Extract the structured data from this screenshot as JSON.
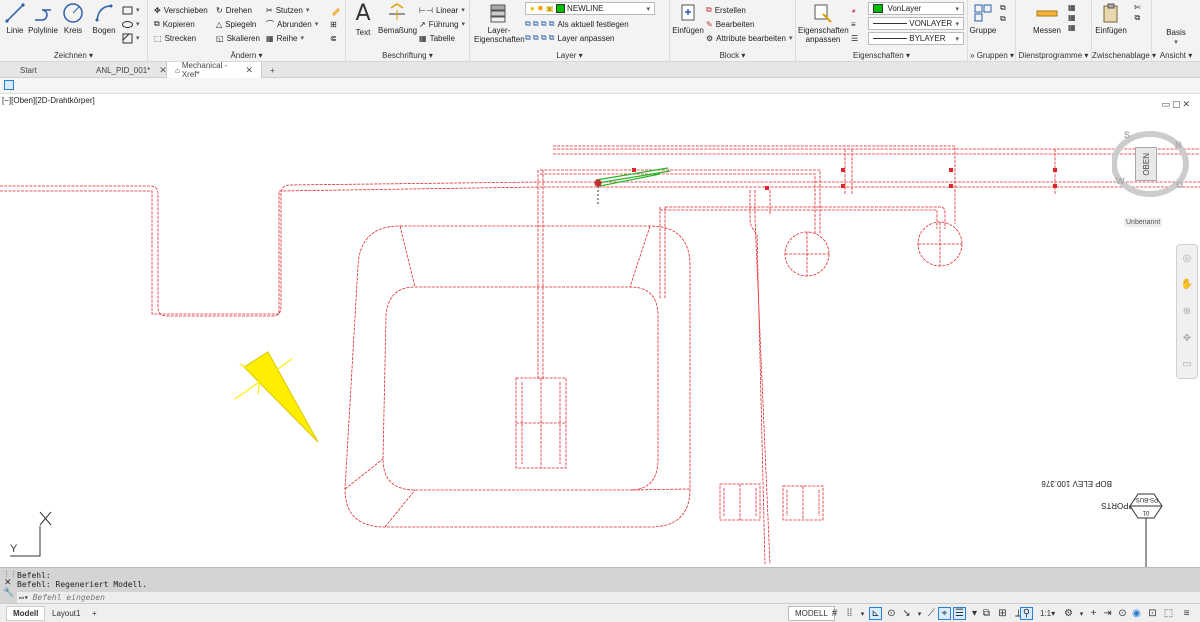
{
  "ribbon": {
    "zeichnen": {
      "title": "Zeichnen",
      "linie": "Linie",
      "polylinie": "Polylinie",
      "kreis": "Kreis",
      "bogen": "Bogen"
    },
    "aendern": {
      "title": "Ändern",
      "verschieben": "Verschieben",
      "drehen": "Drehen",
      "stutzen": "Stutzen",
      "kopieren": "Kopieren",
      "spiegeln": "Spiegeln",
      "abrunden": "Abrunden",
      "strecken": "Strecken",
      "skalieren": "Skalieren",
      "reihe": "Reihe"
    },
    "beschriftung": {
      "title": "Beschriftung",
      "text": "Text",
      "bemassung": "Bemaßung",
      "linear": "Linear",
      "fuehrung": "Führung",
      "tabelle": "Tabelle"
    },
    "layer": {
      "title": "Layer",
      "eigenschaften_line1": "Layer-",
      "eigenschaften_line2": "Eigenschaften",
      "current": "NEWLINE",
      "current_color": "#00c000",
      "als_aktuell": "Als aktuell festlegen",
      "layer_anpassen": "Layer anpassen"
    },
    "block": {
      "title": "Block",
      "einfuegen": "Einfügen",
      "erstellen": "Erstellen",
      "bearbeiten": "Bearbeiten",
      "attribute": "Attribute bearbeiten"
    },
    "eigenschaften": {
      "title": "Eigenschaften",
      "anpassen_line1": "Eigenschaften",
      "anpassen_line2": "anpassen",
      "color": "VonLayer",
      "color_swatch": "#00c000",
      "linetype": "VONLAYER",
      "lineweight": "BYLAYER"
    },
    "gruppen": {
      "title": "Gruppen",
      "gruppe": "Gruppe"
    },
    "dienstprogramme": {
      "title": "Dienstprogramme",
      "messen": "Messen"
    },
    "zwischenablage": {
      "title": "Zwischenablage",
      "einfuegen": "Einfügen"
    },
    "ansicht": {
      "title": "Ansicht",
      "basis": "Basis"
    },
    "overflow": "»"
  },
  "tabs": {
    "start": "Start",
    "anl": "ANL_PID_001*",
    "mechanical": "Mechanical - Xref*",
    "add": "+"
  },
  "viewport": {
    "label": "[−][Oben][2D-Drahtkörper]",
    "viewcube_face": "OBEN",
    "viewcube_n": "N",
    "viewcube_s": "S",
    "viewcube_w": "W",
    "viewcube_o": "O",
    "wcs_label": "Unbenannt",
    "ucs_x": "X",
    "ucs_y": "Y",
    "annot_bop": "BOP ELEV 100.376",
    "annot_supports": "SUPPORTS",
    "annot_tag_top": "PS-BUS-",
    "annot_tag_bottom": "01",
    "colors": {
      "pipe": "#e0262b",
      "cone": "#ffee00",
      "green": "#28b428"
    }
  },
  "command": {
    "line1": "Befehl:",
    "line2": "Befehl: Regeneriert Modell.",
    "placeholder": "Befehl eingeben"
  },
  "statusbar": {
    "modell_tab": "Modell",
    "layout1_tab": "Layout1",
    "add": "+",
    "modell": "MODELL",
    "scale": "1:1"
  }
}
